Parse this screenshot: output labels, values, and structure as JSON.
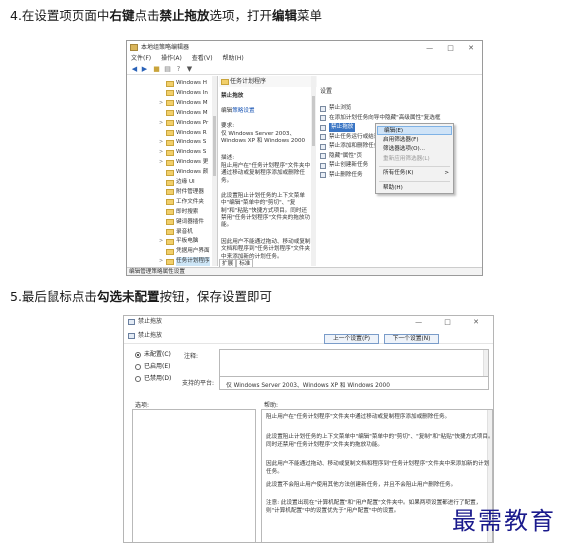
{
  "step4": {
    "pre": "4.在设置项页面中",
    "b1": "右键",
    "mid": "点击",
    "b2": "禁止拖放",
    "post1": "选项，打开",
    "b3": "编辑",
    "post2": "菜单"
  },
  "step5": {
    "pre": "5.最后鼠标点击",
    "b1": "勾选",
    "b2": "未配置",
    "post": "按钮，保存设置即可"
  },
  "editor": {
    "title": "本地组策略编辑器",
    "window_buttons": "— □ ✕",
    "menu": [
      "文件(F)",
      "操作(A)",
      "查看(V)",
      "帮助(H)"
    ],
    "toolbar_icons": [
      "back-arrow-icon",
      "forward-arrow-icon",
      "folder-icon",
      "properties-icon",
      "help-icon",
      "filter-icon"
    ],
    "tree": [
      {
        "label": "Windows H",
        "arrow": ""
      },
      {
        "label": "Windows In",
        "arrow": ""
      },
      {
        "label": "Windows M",
        "arrow": ">"
      },
      {
        "label": "Windows M",
        "arrow": ""
      },
      {
        "label": "Windows Pr",
        "arrow": ">"
      },
      {
        "label": "Windows R",
        "arrow": ""
      },
      {
        "label": "Windows S",
        "arrow": ">"
      },
      {
        "label": "Windows S",
        "arrow": ">"
      },
      {
        "label": "Windows 更",
        "arrow": ">"
      },
      {
        "label": "Windows 颜",
        "arrow": ""
      },
      {
        "label": "边缘 UI",
        "arrow": ""
      },
      {
        "label": "附件管理器",
        "arrow": ""
      },
      {
        "label": "工作文件夹",
        "arrow": ""
      },
      {
        "label": "即时搜索",
        "arrow": ""
      },
      {
        "label": "键词器插件",
        "arrow": ""
      },
      {
        "label": "录音机",
        "arrow": ""
      },
      {
        "label": "平板电脑",
        "arrow": ">"
      },
      {
        "label": "凭据用户界面",
        "arrow": ""
      },
      {
        "label": "任务计划程序",
        "arrow": ">",
        "selected": true
      }
    ],
    "desc": {
      "header": "任务计划程序",
      "policy_name": "禁止拖放",
      "edit_prefix": "编辑",
      "edit_link": "策略设置",
      "req_label": "要求:",
      "req_text": "仅 Windows Server 2003、Windows XP 和 Windows 2000",
      "desc_label": "描述:",
      "desc_text1": "阻止用户在\"任务计划程序\"文件夹中通过移动或复制程序添加或删除任务。",
      "desc_text2": "此设置阻止计划任务的上下文菜单中\"编辑\"菜单中的\"剪切\"、\"复制\"和\"粘贴\"快捷方式项目。同时还禁用\"任务计划程序\"文件夹的拖放功能。",
      "desc_text3": "因此用户不能通过拖动、移动或复制文档和程序到\"任务计划程序\"文件夹中来添加新的计划任务。"
    },
    "settings_header": "设置",
    "settings": [
      "禁止浏览",
      "在添加计划任务向导中隐藏\"高级属性\"复选框",
      "禁止拖放",
      "禁止任务运行或结束",
      "禁止添加和删除任务",
      "隐藏\"属性\"页",
      "禁止创建新任务",
      "禁止删除任务"
    ],
    "settings_selected": 2,
    "context_menu": [
      {
        "label": "编辑(E)",
        "hl": true
      },
      {
        "label": "启用筛选器(F)"
      },
      {
        "label": "筛选器选项(O)..."
      },
      {
        "label": "重新应用筛选器(L)",
        "disabled": true
      },
      {
        "sep": true
      },
      {
        "label": "所有任务(K)",
        "sub": ">"
      },
      {
        "sep": true
      },
      {
        "label": "帮助(H)"
      }
    ],
    "tabs": [
      "扩展",
      "标准"
    ],
    "status": "编辑管理策略属性设置"
  },
  "dialog": {
    "title": "禁止拖放",
    "window_buttons": "— □ ✕",
    "sub_title": "禁止拖放",
    "prev_btn": "上一个设置(P)",
    "next_btn": "下一个设置(N)",
    "radios": [
      {
        "label": "未配置(C)",
        "on": true
      },
      {
        "label": "已启用(E)",
        "on": false
      },
      {
        "label": "已禁用(D)",
        "on": false
      }
    ],
    "comment_label": "注释:",
    "supported_label": "支持的平台:",
    "supported_value": "仅 Windows Server 2003、Windows XP 和 Windows 2000",
    "options_label": "选项:",
    "help_label": "帮助:",
    "help_paragraphs": [
      "阻止用户在\"任务计划程序\"文件夹中通过移动或复制程序添加或删除任务。",
      "此设置阻止计划任务的上下文菜单中\"编辑\"菜单中的\"剪切\"、\"复制\"和\"粘贴\"快捷方式项目。同时还禁用\"任务计划程序\"文件夹的拖放功能。",
      "因此用户不能通过拖动、移动或复制文档和程序到\"任务计划程序\"文件夹中来添加新的计划任务。",
      "此设置不会阻止用户使用其他方法创建新任务，并且不会阻止用户删除任务。",
      "注意: 此设置出现在\"计算机配置\"和\"用户配置\"文件夹中。如果两项设置都进行了配置，则\"计算机配置\"中的设置优先于\"用户配置\"中的设置。"
    ]
  },
  "watermark": "最需教育"
}
